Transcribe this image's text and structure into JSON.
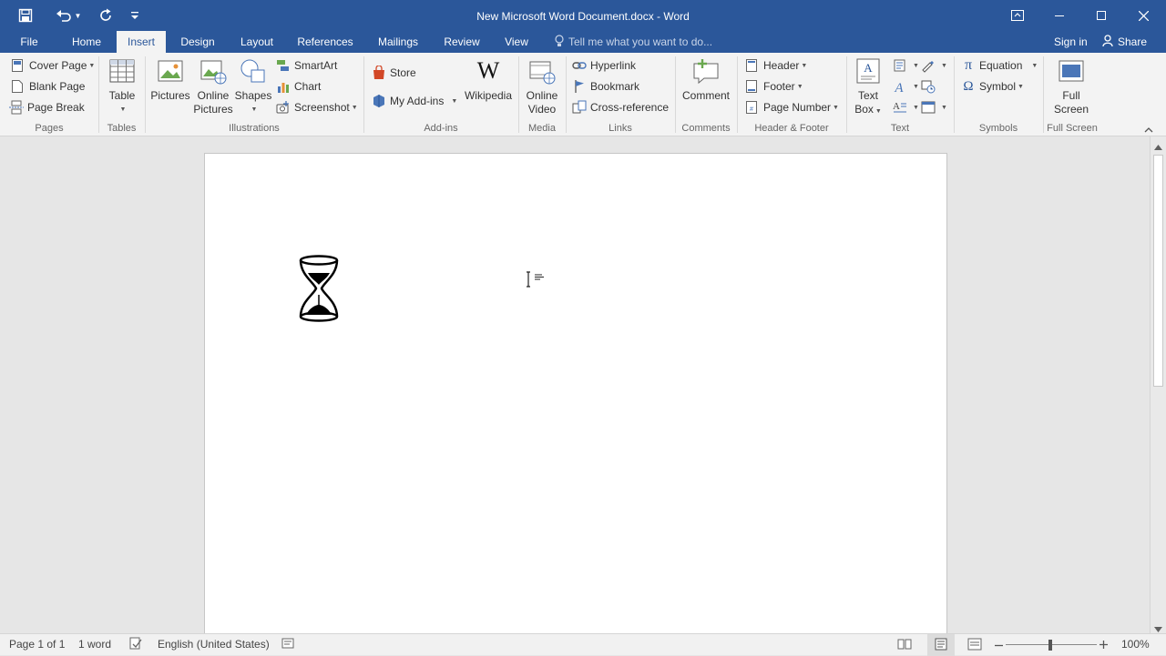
{
  "window": {
    "title": "New Microsoft Word Document.docx - Word",
    "accent": "#2b579a"
  },
  "qat": {
    "icons": [
      "save-icon",
      "undo-icon",
      "redo-icon",
      "customize-icon"
    ]
  },
  "tabs": [
    {
      "label": "File"
    },
    {
      "label": "Home"
    },
    {
      "label": "Insert",
      "active": true
    },
    {
      "label": "Design"
    },
    {
      "label": "Layout"
    },
    {
      "label": "References"
    },
    {
      "label": "Mailings"
    },
    {
      "label": "Review"
    },
    {
      "label": "View"
    }
  ],
  "tell_me": "Tell me what you want to do...",
  "account": {
    "sign_in": "Sign in",
    "share": "Share"
  },
  "ribbon": {
    "pages": {
      "label": "Pages",
      "cover_page": "Cover Page",
      "blank_page": "Blank Page",
      "page_break": "Page Break"
    },
    "tables": {
      "label": "Tables",
      "table": "Table"
    },
    "illustrations": {
      "label": "Illustrations",
      "pictures": "Pictures",
      "online_pictures_1": "Online",
      "online_pictures_2": "Pictures",
      "shapes": "Shapes",
      "smartart": "SmartArt",
      "chart": "Chart",
      "screenshot": "Screenshot"
    },
    "addins": {
      "label": "Add-ins",
      "store": "Store",
      "my_addins": "My Add-ins",
      "wikipedia": "Wikipedia"
    },
    "media": {
      "label": "Media",
      "online_video_1": "Online",
      "online_video_2": "Video"
    },
    "links": {
      "label": "Links",
      "hyperlink": "Hyperlink",
      "bookmark": "Bookmark",
      "cross_reference": "Cross-reference"
    },
    "comments": {
      "label": "Comments",
      "comment": "Comment"
    },
    "header_footer": {
      "label": "Header & Footer",
      "header": "Header",
      "footer": "Footer",
      "page_number": "Page Number"
    },
    "text": {
      "label": "Text",
      "text_box_1": "Text",
      "text_box_2": "Box"
    },
    "symbols": {
      "label": "Symbols",
      "equation": "Equation",
      "symbol": "Symbol"
    },
    "full_screen": {
      "label": "Full Screen",
      "btn_1": "Full",
      "btn_2": "Screen"
    }
  },
  "status": {
    "page": "Page 1 of 1",
    "words": "1 word",
    "language": "English (United States)",
    "zoom": "100%"
  }
}
